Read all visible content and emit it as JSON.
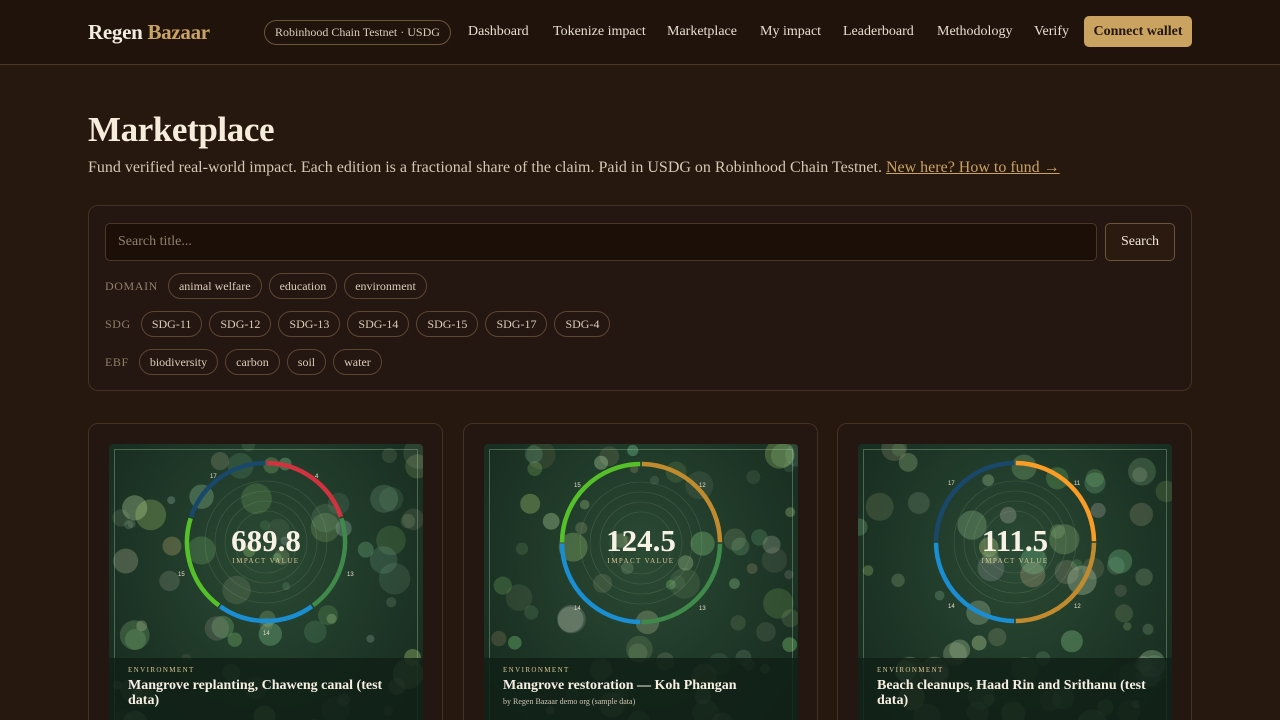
{
  "header": {
    "logo_main": "Regen",
    "logo_accent": "Bazaar",
    "network": "Robinhood Chain Testnet · USDG",
    "nav": [
      "Dashboard",
      "Tokenize impact",
      "Marketplace",
      "My impact",
      "Leaderboard",
      "Methodology",
      "Verify"
    ],
    "connect_label": "Connect wallet"
  },
  "page": {
    "title": "Marketplace",
    "subtitle": "Fund verified real-world impact. Each edition is a fractional share of the claim. Paid in USDG on Robinhood Chain Testnet.",
    "help_link": "New here? How to fund →"
  },
  "filters": {
    "search_placeholder": "Search title...",
    "search_label": "Search",
    "groups": [
      {
        "label": "DOMAIN",
        "chips": [
          "animal welfare",
          "education",
          "environment"
        ]
      },
      {
        "label": "SDG",
        "chips": [
          "SDG-11",
          "SDG-12",
          "SDG-13",
          "SDG-14",
          "SDG-15",
          "SDG-17",
          "SDG-4"
        ]
      },
      {
        "label": "EBF",
        "chips": [
          "biodiversity",
          "carbon",
          "soil",
          "water"
        ]
      }
    ]
  },
  "cards": [
    {
      "value": "689.8",
      "value_label": "IMPACT VALUE",
      "domain": "ENVIRONMENT",
      "title": "Mangrove replanting, Chaweng canal (test data)",
      "by": "",
      "ticks": [
        "17",
        "4",
        "13",
        "14",
        "15"
      ],
      "segments": [
        {
          "color": "#d0333f",
          "fraction": 0.2
        },
        {
          "color": "#3f8a4a",
          "fraction": 0.2
        },
        {
          "color": "#1a8ed0",
          "fraction": 0.2
        },
        {
          "color": "#56c02b",
          "fraction": 0.2
        },
        {
          "color": "#19486a",
          "fraction": 0.2
        }
      ]
    },
    {
      "value": "124.5",
      "value_label": "IMPACT VALUE",
      "domain": "ENVIRONMENT",
      "title": "Mangrove restoration — Koh Phangan",
      "by": "by Regen Bazaar demo org (sample data)",
      "ticks": [
        "15",
        "12",
        "13",
        "14"
      ],
      "segments": [
        {
          "color": "#bf8b2e",
          "fraction": 0.25
        },
        {
          "color": "#3f8a4a",
          "fraction": 0.25
        },
        {
          "color": "#1a8ed0",
          "fraction": 0.25
        },
        {
          "color": "#56c02b",
          "fraction": 0.25
        }
      ]
    },
    {
      "value": "111.5",
      "value_label": "IMPACT VALUE",
      "domain": "ENVIRONMENT",
      "title": "Beach cleanups, Haad Rin and Srithanu (test data)",
      "by": "",
      "ticks": [
        "17",
        "11",
        "12",
        "14"
      ],
      "segments": [
        {
          "color": "#f99d26",
          "fraction": 0.25
        },
        {
          "color": "#bf8b2e",
          "fraction": 0.25
        },
        {
          "color": "#1a8ed0",
          "fraction": 0.25
        },
        {
          "color": "#19486a",
          "fraction": 0.25
        }
      ]
    }
  ]
}
